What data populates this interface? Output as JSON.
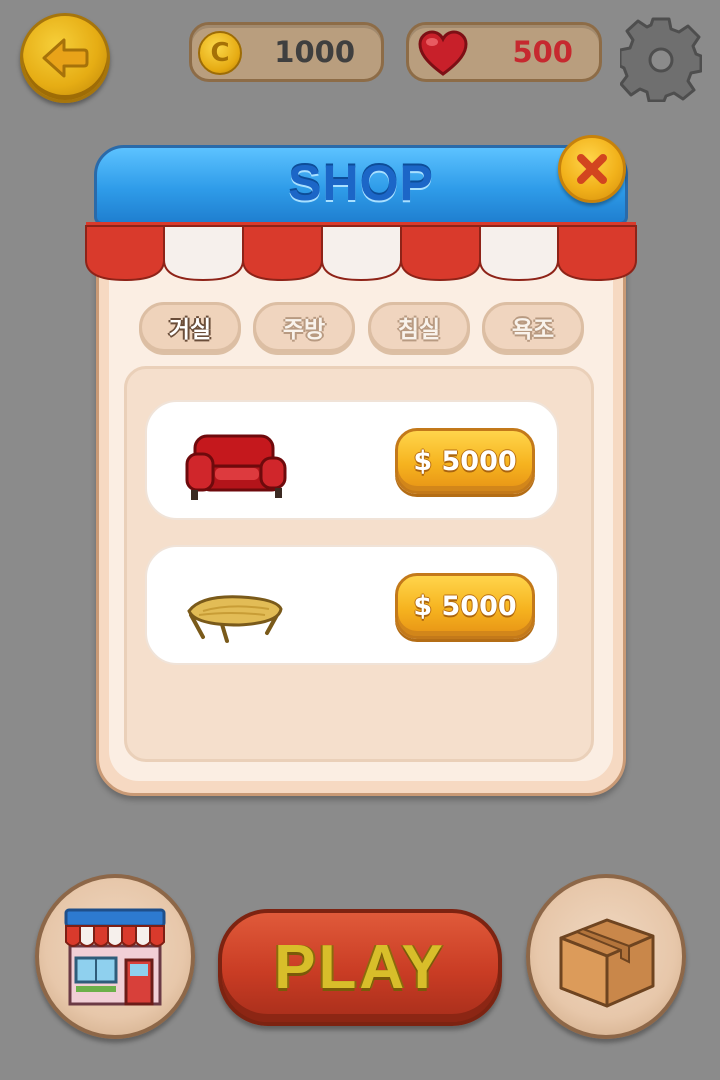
{
  "hud": {
    "back_icon": "arrow-left-icon",
    "coins": {
      "icon": "coin-icon",
      "icon_glyph": "C",
      "value": "1000"
    },
    "hearts": {
      "icon": "heart-icon",
      "value": "500"
    },
    "settings_icon": "gear-icon"
  },
  "shop": {
    "title": "SHOP",
    "close_icon": "close-icon",
    "tabs": [
      {
        "label": "거실",
        "active": true
      },
      {
        "label": "주방",
        "active": false
      },
      {
        "label": "침실",
        "active": false
      },
      {
        "label": "욕조",
        "active": false
      }
    ],
    "items": [
      {
        "icon": "sofa-icon",
        "price": "$ 5000"
      },
      {
        "icon": "table-icon",
        "price": "$ 5000"
      }
    ]
  },
  "bottom": {
    "store_icon": "store-icon",
    "play_label": "PLAY",
    "box_icon": "box-icon"
  },
  "colors": {
    "background": "#8b8b8b",
    "header_blue": "#2f9ce9",
    "awning_red": "#d93a2c",
    "gold": "#f6b31f",
    "play_red": "#c93c24"
  }
}
